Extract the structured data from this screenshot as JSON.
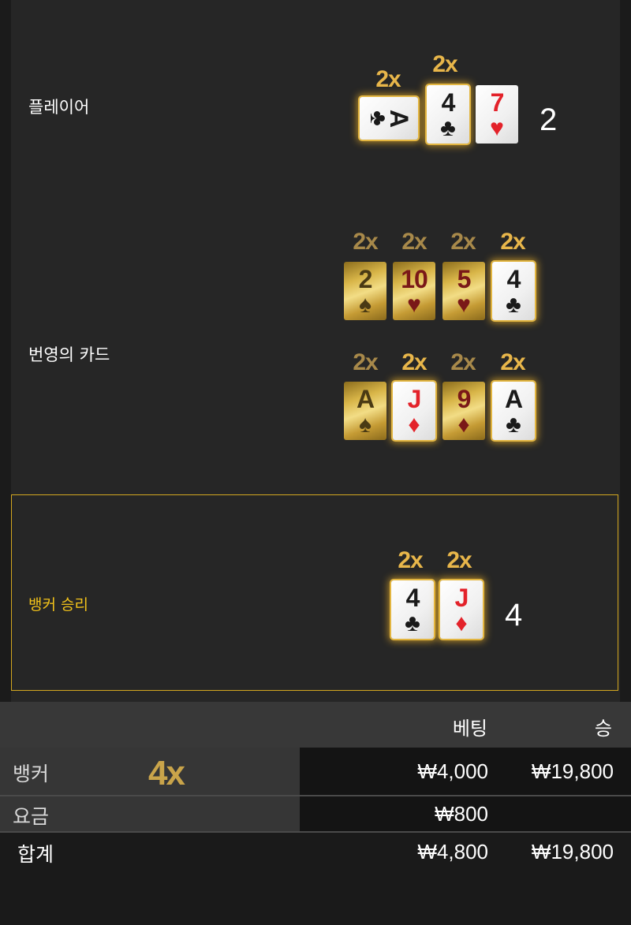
{
  "rows": {
    "player": {
      "label": "플레이어",
      "score": "2",
      "cards": [
        {
          "rank": "A",
          "suit": "♣",
          "color": "black",
          "multiplier": "2x",
          "style": "white-glow-sideways"
        },
        {
          "rank": "4",
          "suit": "♣",
          "color": "black",
          "multiplier": "2x",
          "style": "white-glow"
        },
        {
          "rank": "7",
          "suit": "♥",
          "color": "red",
          "multiplier": "",
          "style": "white"
        }
      ]
    },
    "fortune": {
      "label": "번영의 카드",
      "row1": [
        {
          "rank": "2",
          "suit": "♠",
          "color": "black",
          "multiplier": "2x",
          "style": "gold"
        },
        {
          "rank": "10",
          "suit": "♥",
          "color": "red",
          "multiplier": "2x",
          "style": "gold"
        },
        {
          "rank": "5",
          "suit": "♥",
          "color": "red",
          "multiplier": "2x",
          "style": "gold"
        },
        {
          "rank": "4",
          "suit": "♣",
          "color": "black",
          "multiplier": "2x",
          "style": "white-glow"
        }
      ],
      "row2": [
        {
          "rank": "A",
          "suit": "♠",
          "color": "black",
          "multiplier": "2x",
          "style": "gold"
        },
        {
          "rank": "J",
          "suit": "♦",
          "color": "red",
          "multiplier": "2x",
          "style": "white-glow"
        },
        {
          "rank": "9",
          "suit": "♦",
          "color": "red",
          "multiplier": "2x",
          "style": "gold"
        },
        {
          "rank": "A",
          "suit": "♣",
          "color": "black",
          "multiplier": "2x",
          "style": "white-glow"
        }
      ]
    },
    "banker": {
      "label": "뱅커 승리",
      "score": "4",
      "cards": [
        {
          "rank": "4",
          "suit": "♣",
          "color": "black",
          "multiplier": "2x",
          "style": "white-glow"
        },
        {
          "rank": "J",
          "suit": "♦",
          "color": "red",
          "multiplier": "2x",
          "style": "white-glow"
        }
      ]
    }
  },
  "table": {
    "headers": {
      "bet": "베팅",
      "win": "승"
    },
    "banker": {
      "label": "뱅커",
      "multiplier": "4x",
      "bet": "₩4,000",
      "win": "₩19,800"
    },
    "fee": {
      "label": "요금",
      "bet": "₩800",
      "win": ""
    },
    "total": {
      "label": "합계",
      "bet": "₩4,800",
      "win": "₩19,800"
    }
  },
  "colors": {
    "accent": "#f2c21a",
    "multiplier": "#e8b64a",
    "winner_border": "#d4a820"
  }
}
